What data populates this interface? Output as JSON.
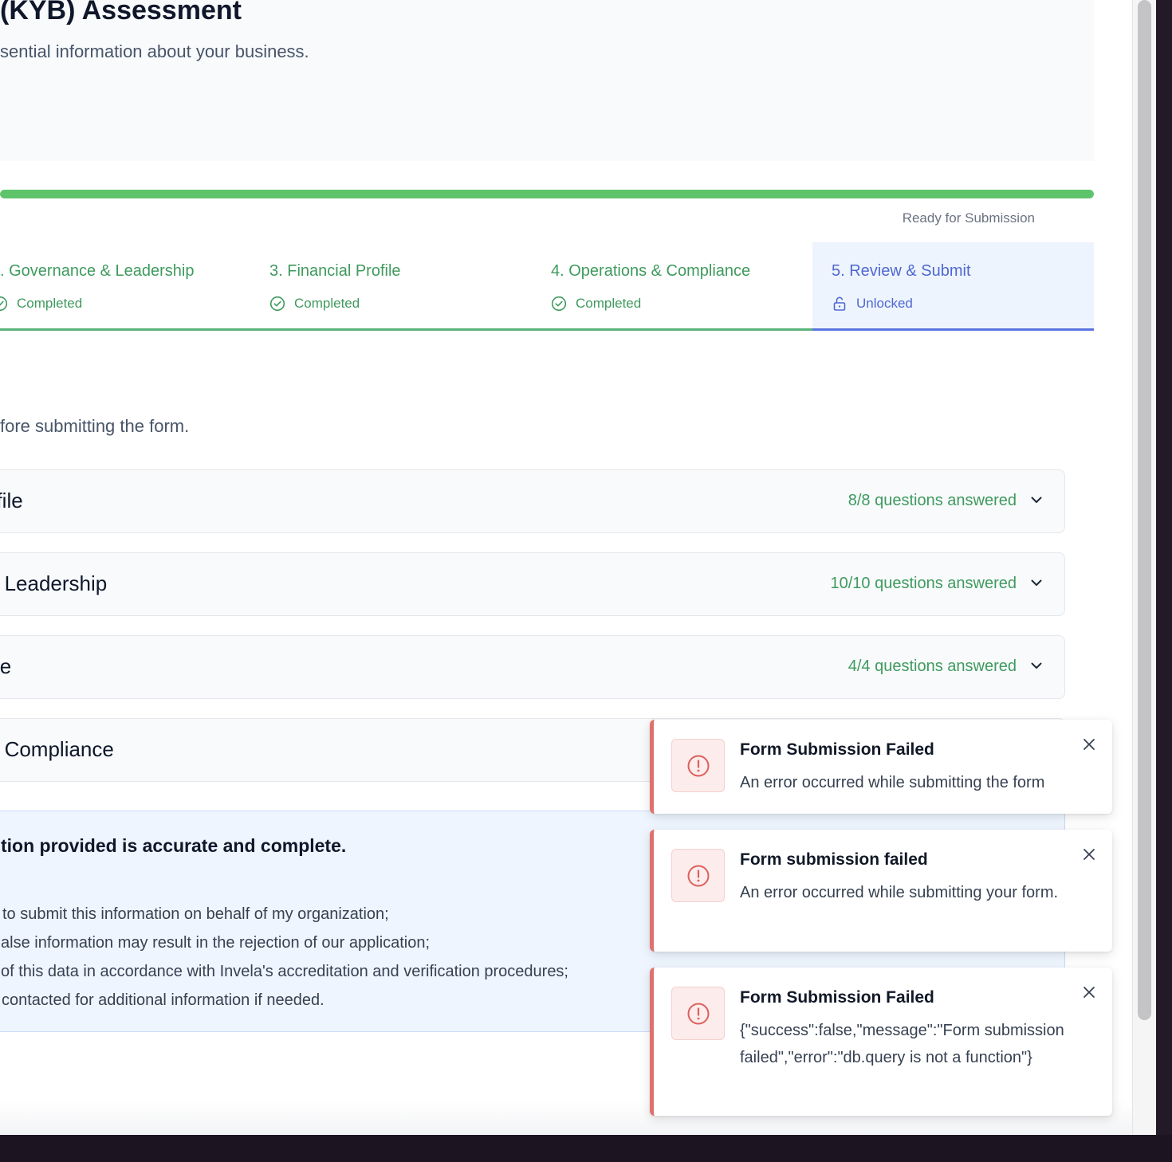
{
  "header": {
    "title": "(KYB) Assessment",
    "subtitle": "sential information about your business."
  },
  "progress": {
    "percent": 100,
    "status": "Ready for Submission",
    "color": "#5ec46b"
  },
  "steps": [
    {
      "label": ". Governance & Leadership",
      "status": "Completed",
      "icon": "check-circle-icon"
    },
    {
      "label": "3. Financial Profile",
      "status": "Completed",
      "icon": "check-circle-icon"
    },
    {
      "label": "4. Operations & Compliance",
      "status": "Completed",
      "icon": "check-circle-icon"
    },
    {
      "label": "5. Review & Submit",
      "status": "Unlocked",
      "icon": "unlock-icon"
    }
  ],
  "review": {
    "description": "fore submitting the form.",
    "sections": [
      {
        "title": "ofile",
        "count": "8/8 questions answered"
      },
      {
        "title": "& Leadership",
        "count": "10/10 questions answered"
      },
      {
        "title": "file",
        "count": "4/4 questions answered"
      },
      {
        "title": "& Compliance",
        "count": ""
      }
    ]
  },
  "agreement": {
    "heading": "tion provided is accurate and complete.",
    "lines": [
      "to submit this information on behalf of my organization;",
      "alse information may result in the rejection of our application;",
      "of this data in accordance with Invela's accreditation and verification procedures;",
      "contacted for additional information if needed."
    ]
  },
  "toasts": [
    {
      "title": "Form Submission Failed",
      "message": "An error occurred while submitting the form",
      "icon": "alert-circle-icon"
    },
    {
      "title": "Form submission failed",
      "message": "An error occurred while submitting your form.",
      "icon": "alert-circle-icon"
    },
    {
      "title": "Form Submission Failed",
      "message": "{\"success\":false,\"message\":\"Form submission failed\",\"error\":\"db.query is not a function\"}",
      "icon": "alert-circle-icon"
    }
  ],
  "colors": {
    "success": "#3f9a5e",
    "accent": "#4f68d0",
    "error": "#e0706d"
  }
}
